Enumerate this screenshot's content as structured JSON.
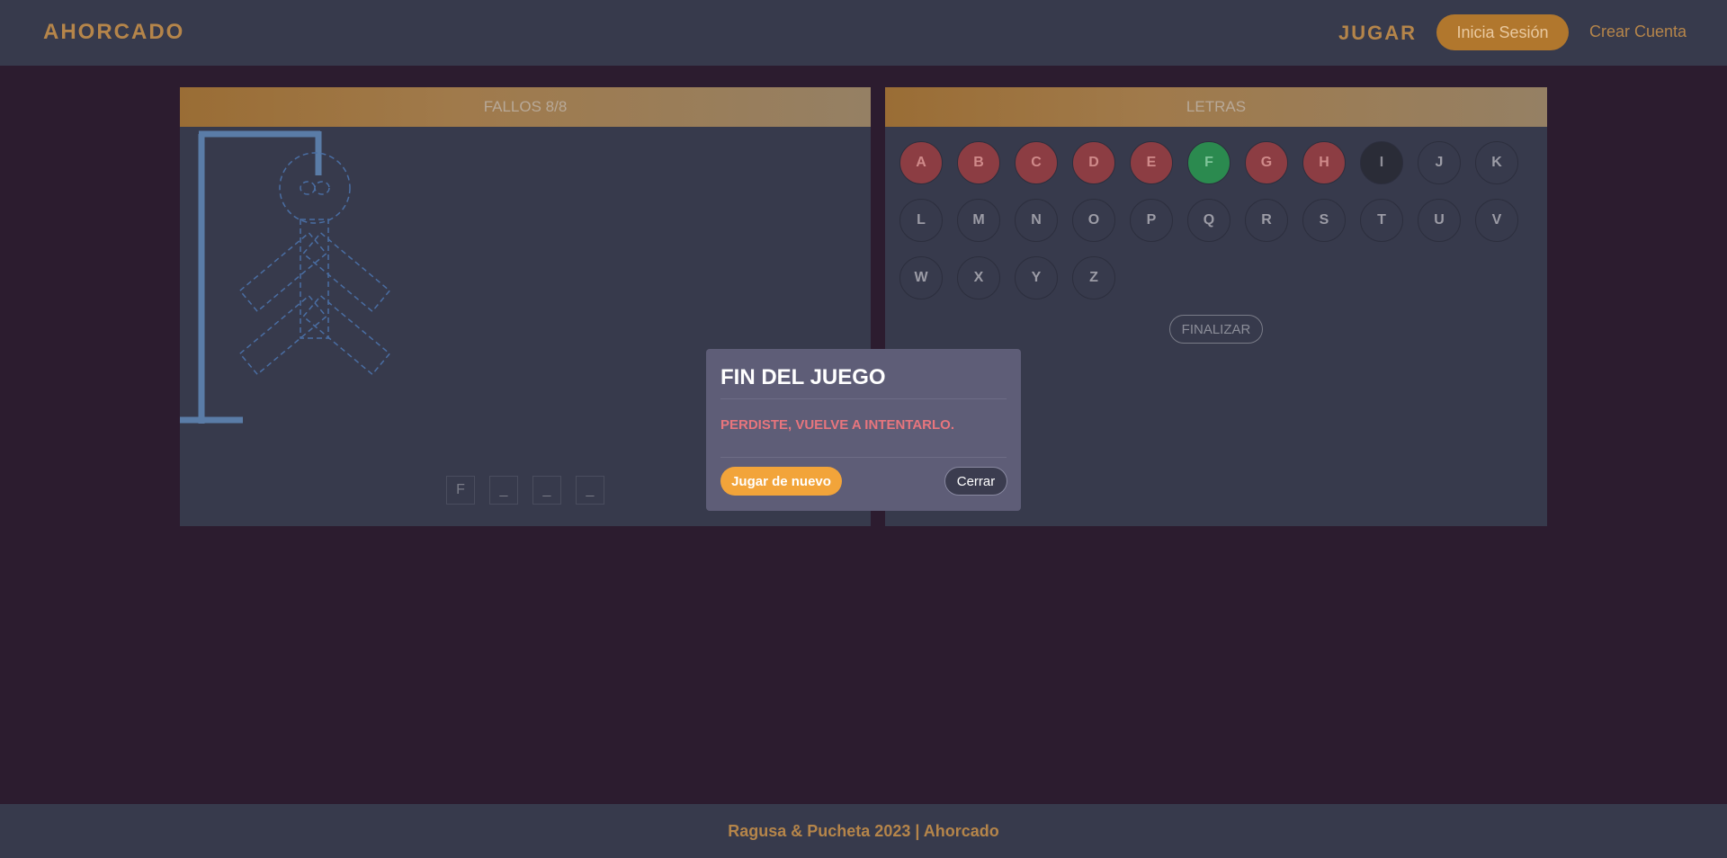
{
  "navbar": {
    "brand": "AHORCADO",
    "play": "JUGAR",
    "login": "Inicia Sesión",
    "register": "Crear Cuenta"
  },
  "hangman": {
    "header": "FALLOS 8/8",
    "word": [
      "F",
      "_",
      "_",
      "_"
    ]
  },
  "letters_panel": {
    "header": "LETRAS",
    "letters": [
      {
        "char": "A",
        "state": "wrong"
      },
      {
        "char": "B",
        "state": "wrong"
      },
      {
        "char": "C",
        "state": "wrong"
      },
      {
        "char": "D",
        "state": "wrong"
      },
      {
        "char": "E",
        "state": "wrong"
      },
      {
        "char": "F",
        "state": "right"
      },
      {
        "char": "G",
        "state": "wrong"
      },
      {
        "char": "H",
        "state": "wrong"
      },
      {
        "char": "I",
        "state": "disabled"
      },
      {
        "char": "J",
        "state": "available"
      },
      {
        "char": "K",
        "state": "available"
      },
      {
        "char": "L",
        "state": "available"
      },
      {
        "char": "M",
        "state": "available"
      },
      {
        "char": "N",
        "state": "available"
      },
      {
        "char": "O",
        "state": "available"
      },
      {
        "char": "P",
        "state": "available"
      },
      {
        "char": "Q",
        "state": "available"
      },
      {
        "char": "R",
        "state": "available"
      },
      {
        "char": "S",
        "state": "available"
      },
      {
        "char": "T",
        "state": "available"
      },
      {
        "char": "U",
        "state": "available"
      },
      {
        "char": "V",
        "state": "available"
      },
      {
        "char": "W",
        "state": "available"
      },
      {
        "char": "X",
        "state": "available"
      },
      {
        "char": "Y",
        "state": "available"
      },
      {
        "char": "Z",
        "state": "available"
      }
    ],
    "finish": "FINALIZAR"
  },
  "modal": {
    "title": "FIN DEL JUEGO",
    "message": "PERDISTE, VUELVE A INTENTARLO.",
    "play_again": "Jugar de nuevo",
    "close": "Cerrar"
  },
  "footer": {
    "text": "Ragusa & Pucheta 2023 | Ahorcado"
  },
  "colors": {
    "background": "#2c1c2f",
    "panel": "#373a4c",
    "accent": "#b5854a",
    "wrong": "#8c3d43",
    "right": "#2b8a4f",
    "modal": "#5e5d77",
    "play_again": "#f2a43a",
    "gallows": "#5a7ca7"
  }
}
